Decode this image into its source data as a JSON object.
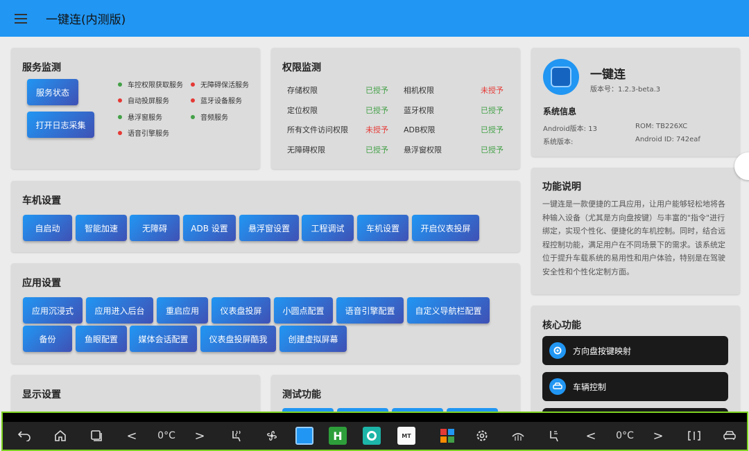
{
  "appbar": {
    "title": "一键连(内测版)",
    "menu_icon": "hamburger-menu-icon"
  },
  "service_monitor": {
    "title": "服务监测",
    "buttons": [
      "服务状态",
      "打开日志采集"
    ],
    "items": [
      {
        "label": "车控权限获取服务",
        "color": "#43a047"
      },
      {
        "label": "无障碍保活服务",
        "color": "#e53935"
      },
      {
        "label": "自动投屏服务",
        "color": "#e53935"
      },
      {
        "label": "蓝牙设备服务",
        "color": "#e53935"
      },
      {
        "label": "悬浮窗服务",
        "color": "#43a047"
      },
      {
        "label": "音频服务",
        "color": "#43a047"
      },
      {
        "label": "语音引擎服务",
        "color": "#e53935"
      }
    ]
  },
  "permission_monitor": {
    "title": "权限监测",
    "rows": [
      {
        "label": "存储权限",
        "status": "已授予",
        "ok": true
      },
      {
        "label": "相机权限",
        "status": "未授予",
        "ok": false
      },
      {
        "label": "定位权限",
        "status": "已授予",
        "ok": true
      },
      {
        "label": "蓝牙权限",
        "status": "已授予",
        "ok": true
      },
      {
        "label": "所有文件访问权限",
        "status": "未授予",
        "ok": false
      },
      {
        "label": "ADB权限",
        "status": "已授予",
        "ok": true
      },
      {
        "label": "无障碍权限",
        "status": "已授予",
        "ok": true
      },
      {
        "label": "悬浮窗权限",
        "status": "已授予",
        "ok": true
      }
    ],
    "ok_color": "#43a047",
    "fail_color": "#e53935"
  },
  "app_info": {
    "name": "一键连",
    "version": "版本号：1.2.3-beta.3",
    "sys_title": "系统信息",
    "android_version": "Android版本: 13",
    "rom": "ROM: TB226XC",
    "system_version": "系统版本:",
    "android_id": "Android ID: 742eaf"
  },
  "vehicle_settings": {
    "title": "车机设置",
    "buttons": [
      "自启动",
      "智能加速",
      "无障碍",
      "ADB 设置",
      "悬浮窗设置",
      "工程调试",
      "车机设置",
      "开启仪表投屏"
    ]
  },
  "app_settings": {
    "title": "应用设置",
    "row1": [
      "应用沉浸式",
      "应用进入后台",
      "重启应用",
      "仪表盘投屏",
      "小圆点配置",
      "语音引擎配置",
      "自定义导航栏配置"
    ],
    "row2": [
      "备份",
      "鱼眼配置",
      "媒体会话配置",
      "仪表盘投屏酷我",
      "创建虚拟屏幕"
    ]
  },
  "display_settings": {
    "title": "显示设置"
  },
  "test_functions": {
    "title": "测试功能"
  },
  "feature_desc": {
    "title": "功能说明",
    "text": "一键连是一款便捷的工具应用，让用户能够轻松地将各种输入设备（尤其是方向盘按键）与丰富的\"指令\"进行绑定，实现个性化、便捷化的车机控制。同时，结合远程控制功能，满足用户在不同场景下的需求。该系统定位于提升车载系统的易用性和用户体验，特别是在驾驶安全性和个性化定制方面。"
  },
  "core_features": {
    "title": "核心功能",
    "items": [
      {
        "label": "方向盘按键映射",
        "icon": "gear-icon"
      },
      {
        "label": "车辆控制",
        "icon": "car-icon"
      }
    ]
  },
  "taskbar": {
    "left_temp": "0°C",
    "right_temp": "0°C",
    "left_arrow": "<",
    "right_arrow": ">",
    "icons": [
      "back-icon",
      "home-icon",
      "recent-apps-icon",
      "seat-heat-icon",
      "fan-icon",
      "app-oneclick-icon",
      "app-h-icon",
      "app-camera-icon",
      "app-mt-icon",
      "app-grid-icon",
      "settings-gear-icon",
      "defrost-icon",
      "seat-vent-icon",
      "split-screen-icon",
      "car-icon"
    ],
    "colors": {
      "border": "#7ed321",
      "h_app": "#2e9e3a"
    }
  }
}
